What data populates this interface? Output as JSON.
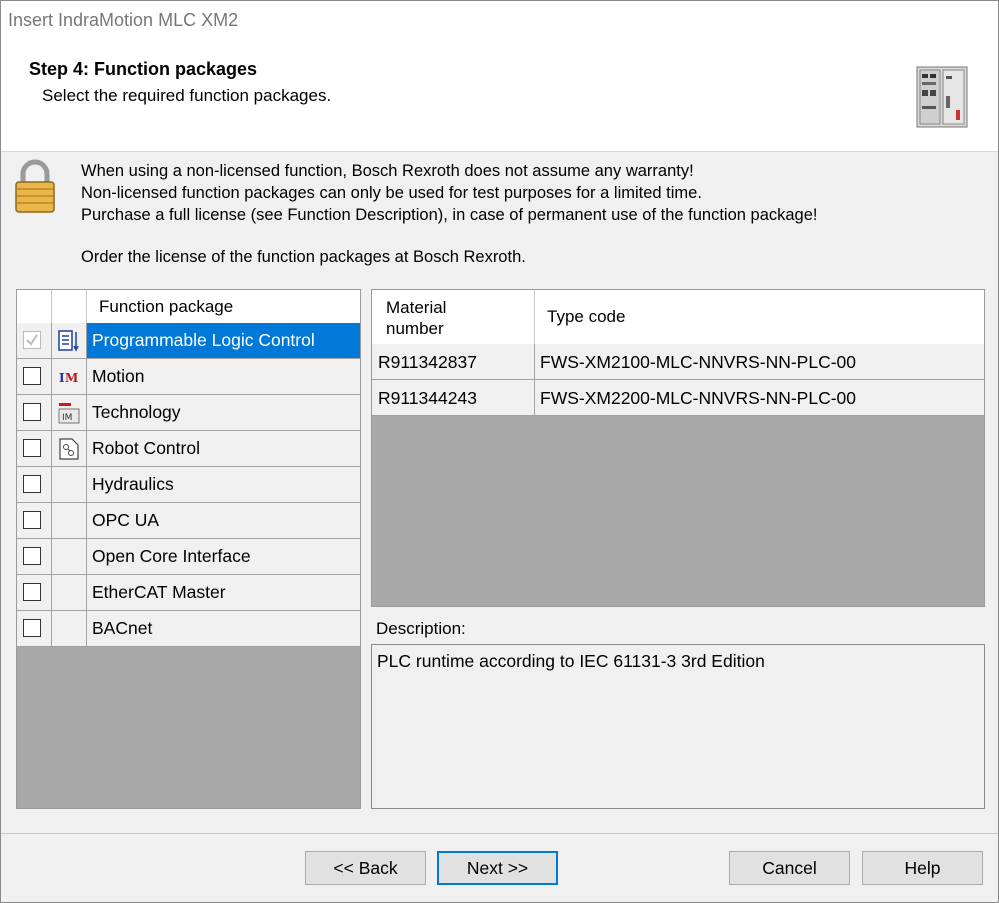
{
  "window": {
    "title": "Insert IndraMotion MLC XM2"
  },
  "header": {
    "step_title": "Step 4: Function packages",
    "step_subtitle": "Select the required function packages."
  },
  "warning": {
    "line1": "When using a non-licensed function, Bosch Rexroth does not assume any warranty!",
    "line2": "Non-licensed function packages can only be used for test purposes for a limited time.",
    "line3": "Purchase a full license (see Function Description), in case of permanent use of the function package!",
    "line4": "Order the license of the function packages at Bosch Rexroth."
  },
  "packages": {
    "header": "Function package",
    "items": [
      {
        "label": "Programmable Logic Control",
        "checked": true,
        "icon": "plc-icon",
        "selected": true
      },
      {
        "label": "Motion",
        "checked": false,
        "icon": "im-motion-icon"
      },
      {
        "label": "Technology",
        "checked": false,
        "icon": "im-technology-icon"
      },
      {
        "label": "Robot Control",
        "checked": false,
        "icon": "robot-control-icon"
      },
      {
        "label": "Hydraulics",
        "checked": false
      },
      {
        "label": "OPC UA",
        "checked": false
      },
      {
        "label": "Open Core Interface",
        "checked": false
      },
      {
        "label": "EtherCAT Master",
        "checked": false
      },
      {
        "label": "BACnet",
        "checked": false
      }
    ]
  },
  "materials": {
    "col_material": "Material number",
    "col_type": "Type code",
    "rows": [
      {
        "material": "R911342837",
        "type": "FWS-XM2100-MLC-NNVRS-NN-PLC-00"
      },
      {
        "material": "R911344243",
        "type": "FWS-XM2200-MLC-NNVRS-NN-PLC-00"
      }
    ]
  },
  "description": {
    "label": "Description:",
    "text": "PLC runtime according to IEC 61131-3 3rd Edition"
  },
  "buttons": {
    "back": "<< Back",
    "next": "Next >>",
    "cancel": "Cancel",
    "help": "Help"
  },
  "colors": {
    "selection": "#0078d7",
    "grid_empty": "#a9a9a9"
  }
}
